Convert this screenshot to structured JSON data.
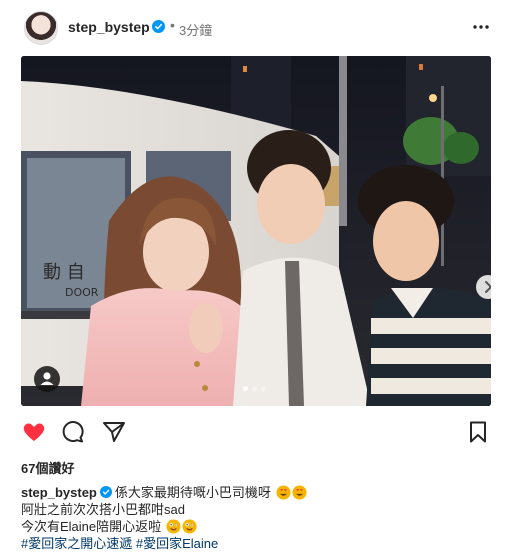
{
  "post": {
    "username": "step_bystep",
    "time": "3分鐘",
    "likes": "67個讚好",
    "caption": {
      "line1": "係大家最期待嘅小巴司機呀",
      "line2": "阿壯之前次次搭小巴都咁sad",
      "line3": "今次有Elaine陪開心返啦",
      "hashtags": [
        "#愛回家之開心速遞",
        "#愛回家Elaine"
      ]
    },
    "photo_overlay": {
      "bus_sign": "動 自",
      "bus_door_text": "DOOR"
    },
    "carousel": {
      "count": 3,
      "active_index": 0
    }
  },
  "colors": {
    "verified": "#0095f6",
    "like": "#ff3040",
    "text": "#262626",
    "secondary": "#737373",
    "hashtag": "#00376b"
  },
  "icons": {
    "more": "more-horizontal-icon",
    "like": "heart-filled-icon",
    "comment": "comment-icon",
    "share": "paper-plane-icon",
    "save": "bookmark-icon",
    "verified": "verified-badge-icon",
    "carousel_next": "chevron-right-icon",
    "user_tag": "user-tag-icon"
  }
}
